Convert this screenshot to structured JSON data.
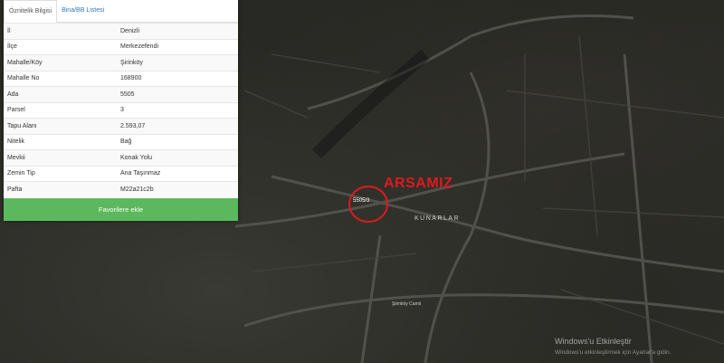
{
  "tabs": [
    {
      "label": "Öznitelik Bilgisi"
    },
    {
      "label": "Bina/BB Listesi"
    }
  ],
  "attributes": [
    {
      "key": "İl",
      "value": "Denizli"
    },
    {
      "key": "İlçe",
      "value": "Merkezefendi"
    },
    {
      "key": "Mahalle/Köy",
      "value": "Şirinköy"
    },
    {
      "key": "Mahalle No",
      "value": "168900"
    },
    {
      "key": "Ada",
      "value": "5505"
    },
    {
      "key": "Parsel",
      "value": "3"
    },
    {
      "key": "Tapu Alanı",
      "value": "2.593,07"
    },
    {
      "key": "Nitelik",
      "value": "Bağ"
    },
    {
      "key": "Mevkii",
      "value": "Konak Yolu"
    },
    {
      "key": "Zemin Tip",
      "value": "Ana Taşınmaz"
    },
    {
      "key": "Pafta",
      "value": "M22a21c2b"
    }
  ],
  "favorite_button": "Favorilere ekle",
  "map": {
    "annotation": "ARSAMIZ",
    "parcel_label": "5505/3",
    "area_label": "KUNARLAR",
    "street_label": "Şirinköy Camii",
    "annotation_color": "#e0191e"
  },
  "windows_watermark": {
    "line1": "Windows'u Etkinleştir",
    "line2": "Windows'u etkinleştirmek için Ayarlar'a gidin."
  }
}
